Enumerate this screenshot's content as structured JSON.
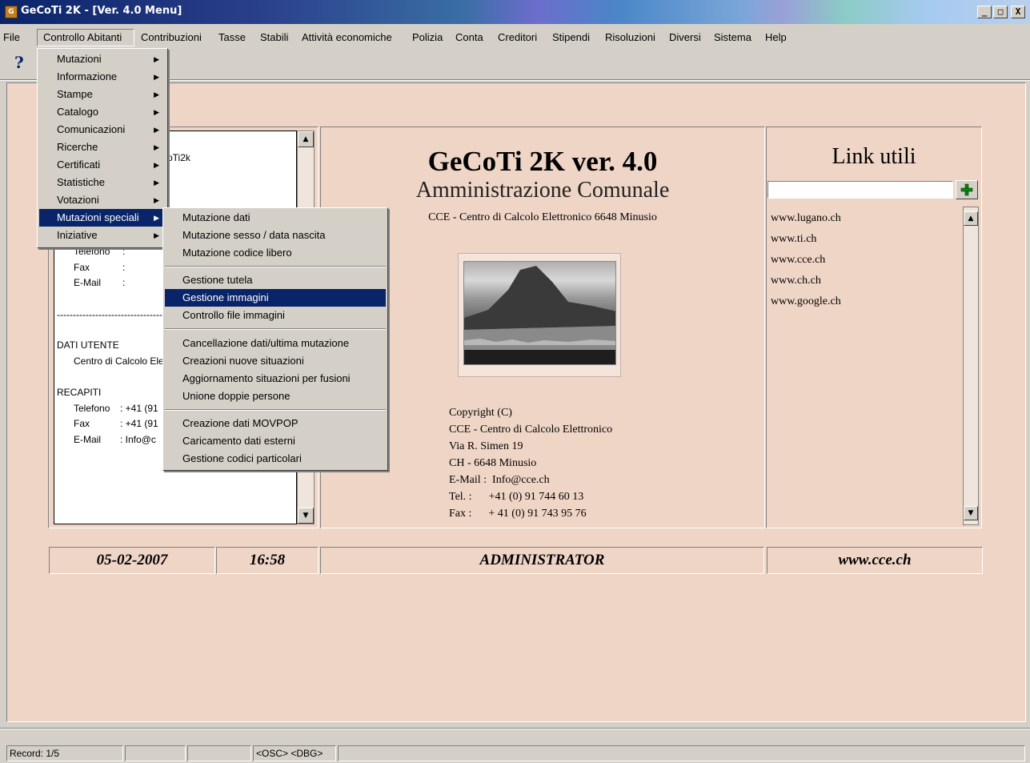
{
  "window": {
    "title": "GeCoTi 2K - [Ver. 4.0 Menu]",
    "minimize": "_",
    "maximize": "□",
    "close": "X"
  },
  "menubar": [
    "File",
    "Controllo Abitanti",
    "Contribuzioni",
    "Tasse",
    "Stabili",
    "Attività economiche",
    "Polizia",
    "Conta",
    "Creditori",
    "Stipendi",
    "Risoluzioni",
    "Diversi",
    "Sistema",
    "Help"
  ],
  "toolbar": {
    "help_glyph": "?"
  },
  "controllo_menu": {
    "items": [
      "Mutazioni",
      "Informazione",
      "Stampe",
      "Catalogo",
      "Comunicazioni",
      "Ricerche",
      "Certificati",
      "Statistiche",
      "Votazioni",
      "Mutazioni speciali",
      "Iniziative"
    ],
    "active": "Mutazioni speciali"
  },
  "mutazioni_speciali_menu": {
    "group1": [
      "Mutazione dati",
      "Mutazione sesso / data nascita",
      "Mutazione codice libero"
    ],
    "group2": [
      "Gestione tutela",
      "Gestione immagini",
      "Controllo file immagini"
    ],
    "group3": [
      "Cancellazione dati/ultima mutazione",
      "Creazioni nuove situazioni",
      "Aggiornamento situazioni per fusioni",
      "Unione doppie persone"
    ],
    "group4": [
      "Creazione dati MOVPOP",
      "Caricamento dati esterni",
      "Gestione codici particolari"
    ],
    "highlighted": "Gestione immagini"
  },
  "left_panel": {
    "partial_title": "oTi2k",
    "contact_labels": [
      "Telefono",
      "Fax",
      "E-Mail"
    ],
    "colon": ":",
    "divider": "------------------------------------------",
    "dati_utente_header": "DATI UTENTE",
    "dati_utente_name": "Centro di Calcolo Ele",
    "recapiti_header": "RECAPITI",
    "recapiti": [
      {
        "label": "Telefono",
        "value": ": +41 (91"
      },
      {
        "label": "Fax",
        "value": ": +41 (91"
      },
      {
        "label": "E-Mail",
        "value": ": Info@c"
      }
    ]
  },
  "center": {
    "title": "GeCoTi 2K ver. 4.0",
    "subtitle": "Amministrazione Comunale",
    "company": "CCE - Centro di Calcolo Elettronico 6648 Minusio",
    "copyright": [
      "Copyright (C)",
      "CCE - Centro di Calcolo Elettronico",
      "Via R. Simen 19",
      "CH - 6648 Minusio",
      "E-Mail :  Info@cce.ch",
      "Tel. :      +41 (0) 91 744 60 13",
      "Fax :      + 41 (0) 91 743 95 76"
    ]
  },
  "links": {
    "title": "Link utili",
    "input_value": "",
    "items": [
      "www.lugano.ch",
      "www.ti.ch",
      "www.cce.ch",
      "www.ch.ch",
      "www.google.ch"
    ]
  },
  "status": {
    "date": "05-02-2007",
    "time": "16:58",
    "user": "ADMINISTRATOR",
    "website": "www.cce.ch"
  },
  "statusbar": {
    "record": "Record: 1/5",
    "p2": "",
    "p3": "",
    "p4": "",
    "flags": "<OSC> <DBG>",
    "p6": ""
  }
}
